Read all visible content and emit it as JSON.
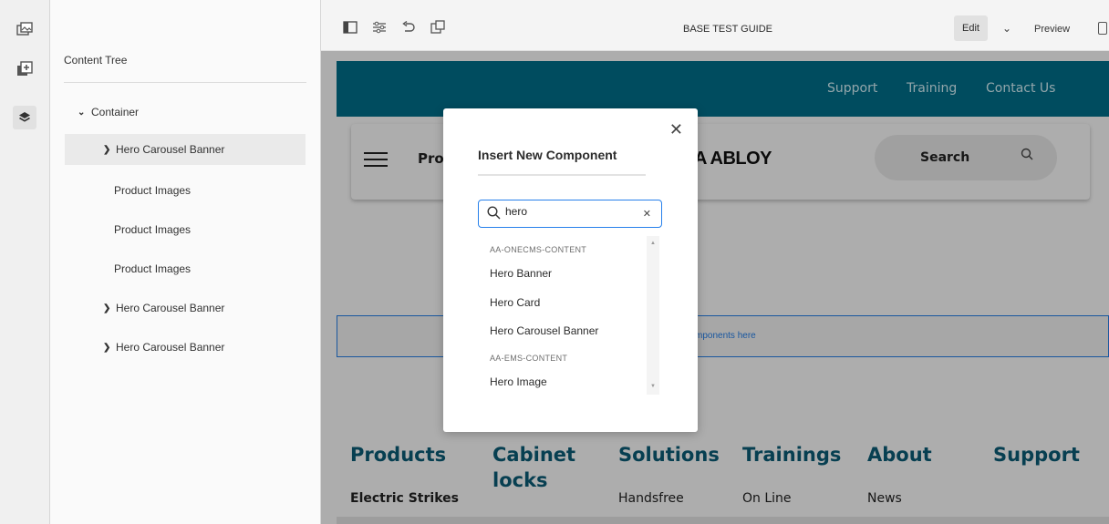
{
  "rail": {
    "items": [
      {
        "icon": "page-assets-icon"
      },
      {
        "icon": "add-component-icon"
      },
      {
        "icon": "layers-icon",
        "active": true
      }
    ]
  },
  "tree": {
    "title": "Content Tree",
    "rows": [
      {
        "label": "Container",
        "expander": "expanded"
      },
      {
        "label": "Hero Carousel Banner",
        "expander": "collapsed",
        "selected": true
      },
      {
        "label": "Product Images",
        "expander": "none"
      },
      {
        "label": "Product Images",
        "expander": "none"
      },
      {
        "label": "Product Images",
        "expander": "none"
      },
      {
        "label": "Hero Carousel Banner",
        "expander": "collapsed"
      },
      {
        "label": "Hero Carousel Banner",
        "expander": "collapsed"
      }
    ]
  },
  "toolbar": {
    "title": "BASE TEST GUIDE",
    "mode": "Edit",
    "preview": "Preview",
    "icons": [
      "side-panel-toggle-icon",
      "page-properties-icon",
      "undo-icon",
      "emulator-icon"
    ]
  },
  "page": {
    "topnav": [
      "Support",
      "Training",
      "Contact Us"
    ],
    "header_product": "Pro",
    "logo": "A ABLOY",
    "search_label": "Search",
    "dropzone_text": "mponents here",
    "footer": {
      "heads": [
        "Products",
        "Cabinet locks",
        "Solutions",
        "Trainings",
        "About",
        "Support"
      ],
      "links": [
        "Electric Strikes",
        "Handsfree",
        "On Line",
        "News"
      ]
    }
  },
  "modal": {
    "title": "Insert New Component",
    "search_value": "hero",
    "groups": [
      {
        "name": "AA-ONECMS-CONTENT",
        "items": [
          "Hero Banner",
          "Hero Card",
          "Hero Carousel Banner"
        ]
      },
      {
        "name": "AA-EMS-CONTENT",
        "items": [
          "Hero Image"
        ]
      }
    ]
  },
  "colors": {
    "brand_teal": "#00708c",
    "footer_heading": "#0b5d78",
    "accent_blue": "#2680eb"
  }
}
